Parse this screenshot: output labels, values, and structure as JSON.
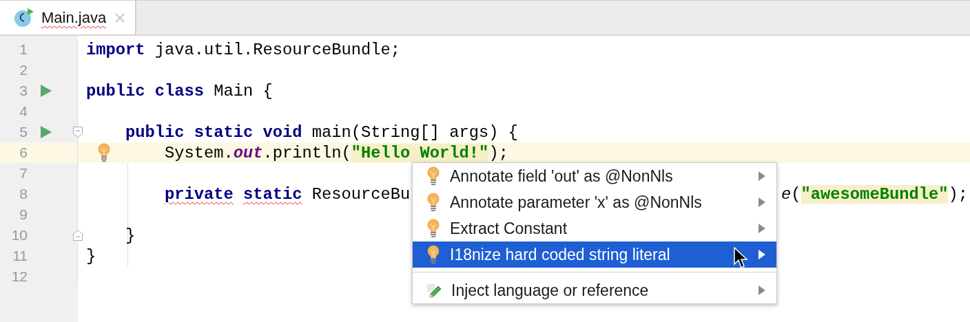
{
  "tab": {
    "title": "Main.java",
    "selected": true
  },
  "lines": [
    {
      "number": "1",
      "run": false,
      "fold_start": false,
      "fold_end": false,
      "current": false,
      "bulb": false,
      "tokens": [
        {
          "kind": "keyword",
          "text": "import"
        },
        {
          "kind": "plain",
          "text": " java.util.ResourceBundle;"
        }
      ]
    },
    {
      "number": "2",
      "run": false,
      "fold_start": false,
      "fold_end": false,
      "current": false,
      "bulb": false
    },
    {
      "number": "3",
      "run": true,
      "fold_start": false,
      "fold_end": false,
      "current": false,
      "bulb": false,
      "tokens": [
        {
          "kind": "keyword",
          "text": "public class"
        },
        {
          "kind": "plain",
          "text": " Main {"
        }
      ],
      "children": [
        {
          "number": "4",
          "run": false,
          "fold_start": false,
          "fold_end": false,
          "current": false,
          "bulb": false
        },
        {
          "number": "5",
          "run": true,
          "fold_start": true,
          "fold_end": false,
          "current": false,
          "bulb": false,
          "tokens": [
            {
              "kind": "keyword",
              "text": "public static void"
            },
            {
              "kind": "plain",
              "text": " main(String[] args) {"
            }
          ],
          "children": [
            {
              "number": "6",
              "run": false,
              "fold_start": false,
              "fold_end": false,
              "current": true,
              "bulb": true,
              "tokens": [
                {
                  "kind": "plain",
                  "text": "System."
                },
                {
                  "kind": "static-field",
                  "text": "out"
                },
                {
                  "kind": "plain",
                  "text": ".println("
                },
                {
                  "kind": "string",
                  "text": "\"Hello World!\""
                },
                {
                  "kind": "plain",
                  "text": ");"
                }
              ]
            },
            {
              "number": "7",
              "run": false,
              "fold_start": false,
              "fold_end": false,
              "current": false,
              "bulb": false
            },
            {
              "number": "8",
              "run": false,
              "fold_start": false,
              "fold_end": false,
              "current": false,
              "bulb": false,
              "tokens": [
                {
                  "kind": "error-keyword",
                  "text": "private"
                },
                {
                  "kind": "error-keyword",
                  "text": "static"
                },
                {
                  "kind": "plain",
                  "text": " ResourceBu"
                },
                {
                  "kind": "gap"
                },
                {
                  "kind": "method",
                  "text": "e"
                },
                {
                  "kind": "plain",
                  "text": "("
                },
                {
                  "kind": "string",
                  "text": "\"awesomeBundle\""
                },
                {
                  "kind": "plain",
                  "text": ");"
                }
              ]
            },
            {
              "number": "9",
              "run": false,
              "fold_start": false,
              "fold_end": false,
              "current": false,
              "bulb": false
            }
          ]
        },
        {
          "number": "10",
          "run": false,
          "fold_start": false,
          "fold_end": true,
          "current": false,
          "bulb": false,
          "tokens": [
            {
              "kind": "plain",
              "text": "}"
            }
          ]
        }
      ]
    },
    {
      "number": "11",
      "run": false,
      "fold_start": false,
      "fold_end": false,
      "current": false,
      "bulb": false,
      "tokens": [
        {
          "kind": "plain",
          "text": "}"
        }
      ]
    },
    {
      "number": "12",
      "run": false,
      "fold_start": false,
      "fold_end": false,
      "current": false,
      "bulb": false
    }
  ],
  "popup": {
    "items": [
      {
        "kind": "bulb",
        "label": "Annotate field 'out' as @NonNls",
        "selected": false
      },
      {
        "kind": "bulb",
        "label": "Annotate parameter 'x' as @NonNls",
        "selected": false
      },
      {
        "kind": "bulb",
        "label": "Extract Constant",
        "selected": false
      },
      {
        "kind": "bulb",
        "label": "I18nize hard coded string literal",
        "selected": true
      },
      {
        "kind": "separator"
      },
      {
        "kind": "pencil",
        "label": "Inject language or reference",
        "selected": false
      }
    ]
  }
}
